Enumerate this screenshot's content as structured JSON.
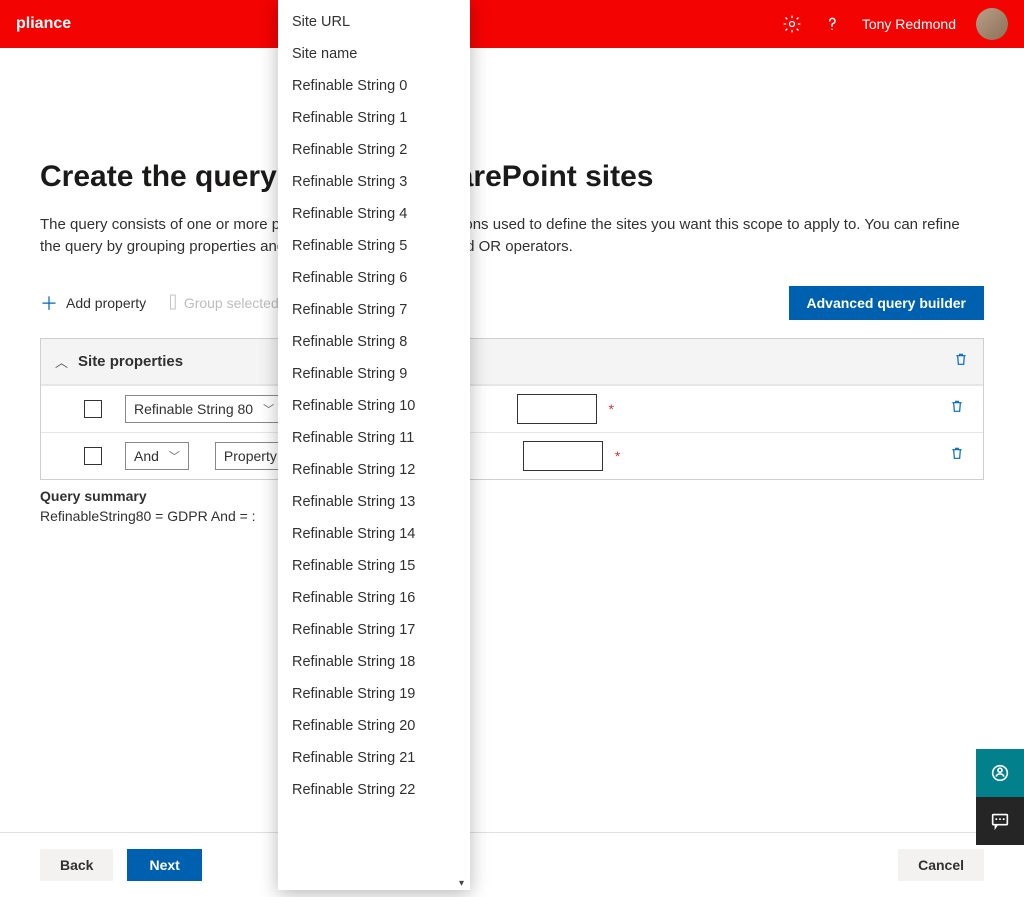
{
  "topbar": {
    "app_title_fragment": "pliance",
    "user_name": "Tony Redmond"
  },
  "page": {
    "title": "Create the query to define SharePoint sites",
    "description": "The query consists of one or more property/value pair combinations used to define the sites you want this scope to apply to. You can refine the query by grouping properties and joining them using AND and OR operators."
  },
  "toolbar": {
    "add_property_label": "Add property",
    "group_selected_label": "Group selected",
    "advanced_builder_label": "Advanced query builder"
  },
  "section": {
    "title": "Site properties",
    "rows": [
      {
        "property": "Refinable String 80"
      },
      {
        "operator": "And",
        "property": "Property"
      }
    ]
  },
  "summary": {
    "label": "Query summary",
    "text": "RefinableString80 = GDPR And = :"
  },
  "footer": {
    "back": "Back",
    "next": "Next",
    "cancel": "Cancel"
  },
  "dropdown": {
    "items": [
      "Site URL",
      "Site name",
      "Refinable String 0",
      "Refinable String 1",
      "Refinable String 2",
      "Refinable String 3",
      "Refinable String 4",
      "Refinable String 5",
      "Refinable String 6",
      "Refinable String 7",
      "Refinable String 8",
      "Refinable String 9",
      "Refinable String 10",
      "Refinable String 11",
      "Refinable String 12",
      "Refinable String 13",
      "Refinable String 14",
      "Refinable String 15",
      "Refinable String 16",
      "Refinable String 17",
      "Refinable String 18",
      "Refinable String 19",
      "Refinable String 20",
      "Refinable String 21",
      "Refinable String 22"
    ]
  }
}
